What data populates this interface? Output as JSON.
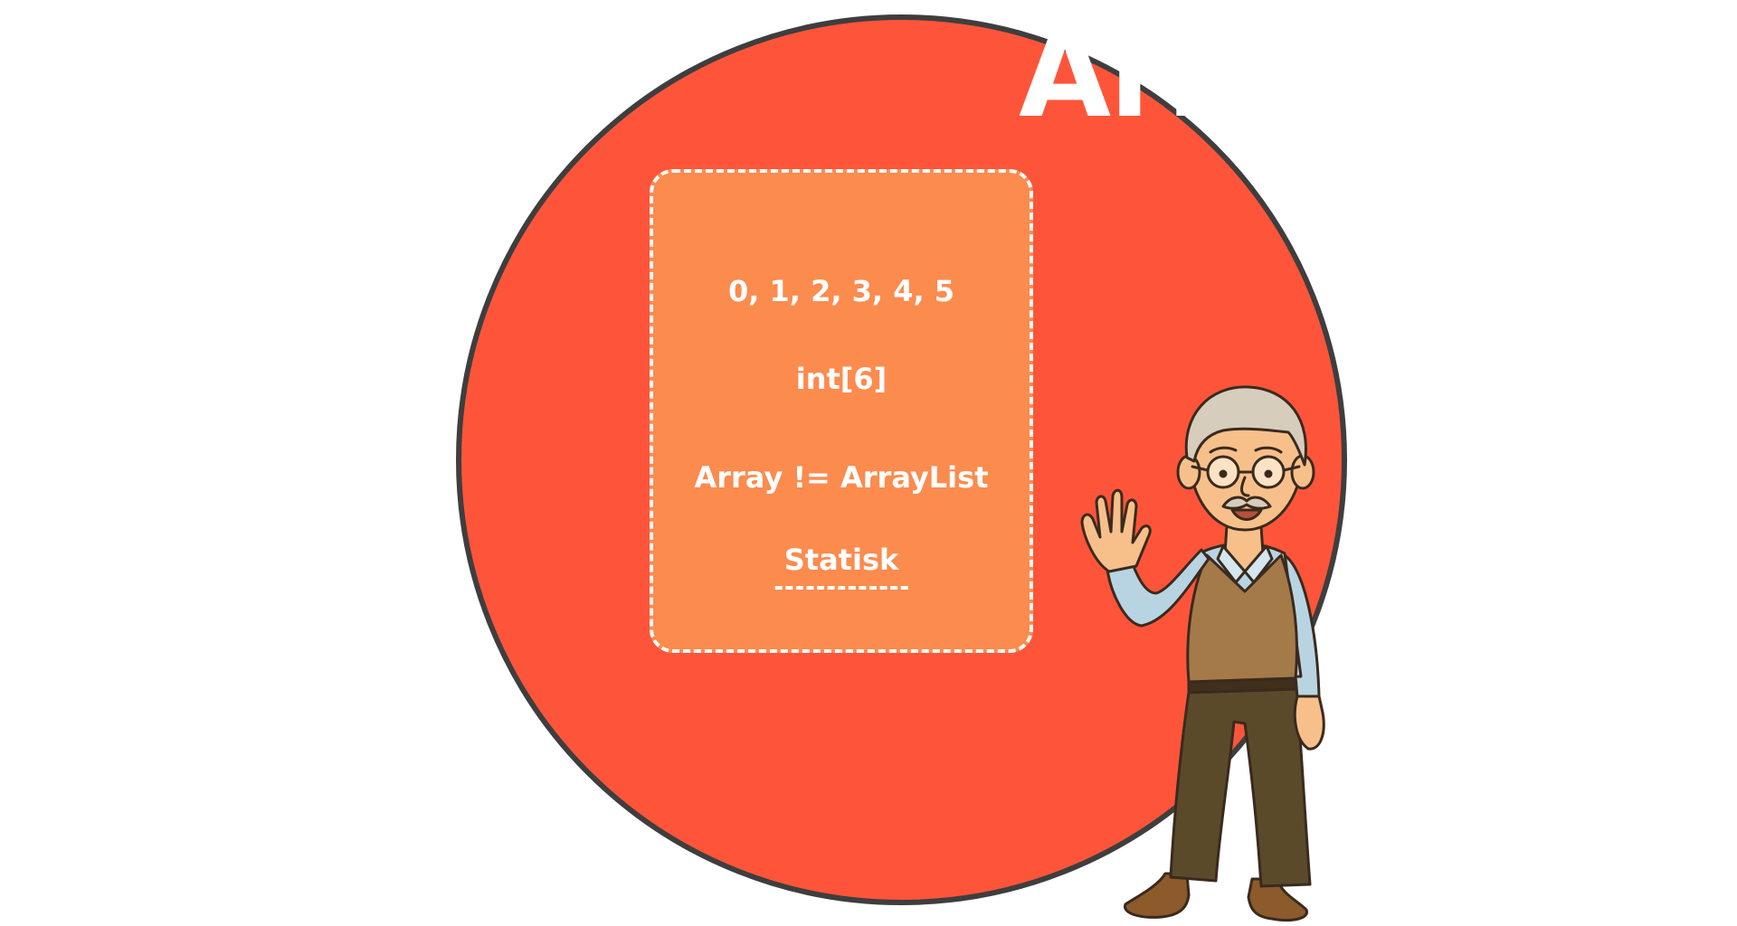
{
  "slide": {
    "heading": "Arr",
    "card": {
      "line_1": "0, 1, 2, 3, 4, 5",
      "line_2": "int[6]",
      "line_3": "Array != ArrayList",
      "line_4": "Statisk"
    }
  },
  "colors": {
    "background": "#ffffff",
    "circle_fill": "#fe553a",
    "circle_border": "#3e3e3e",
    "card_fill": "#fc8b4e",
    "card_text": "#ffffff"
  },
  "icons": {
    "presenter": "waving-old-man-illustration"
  }
}
